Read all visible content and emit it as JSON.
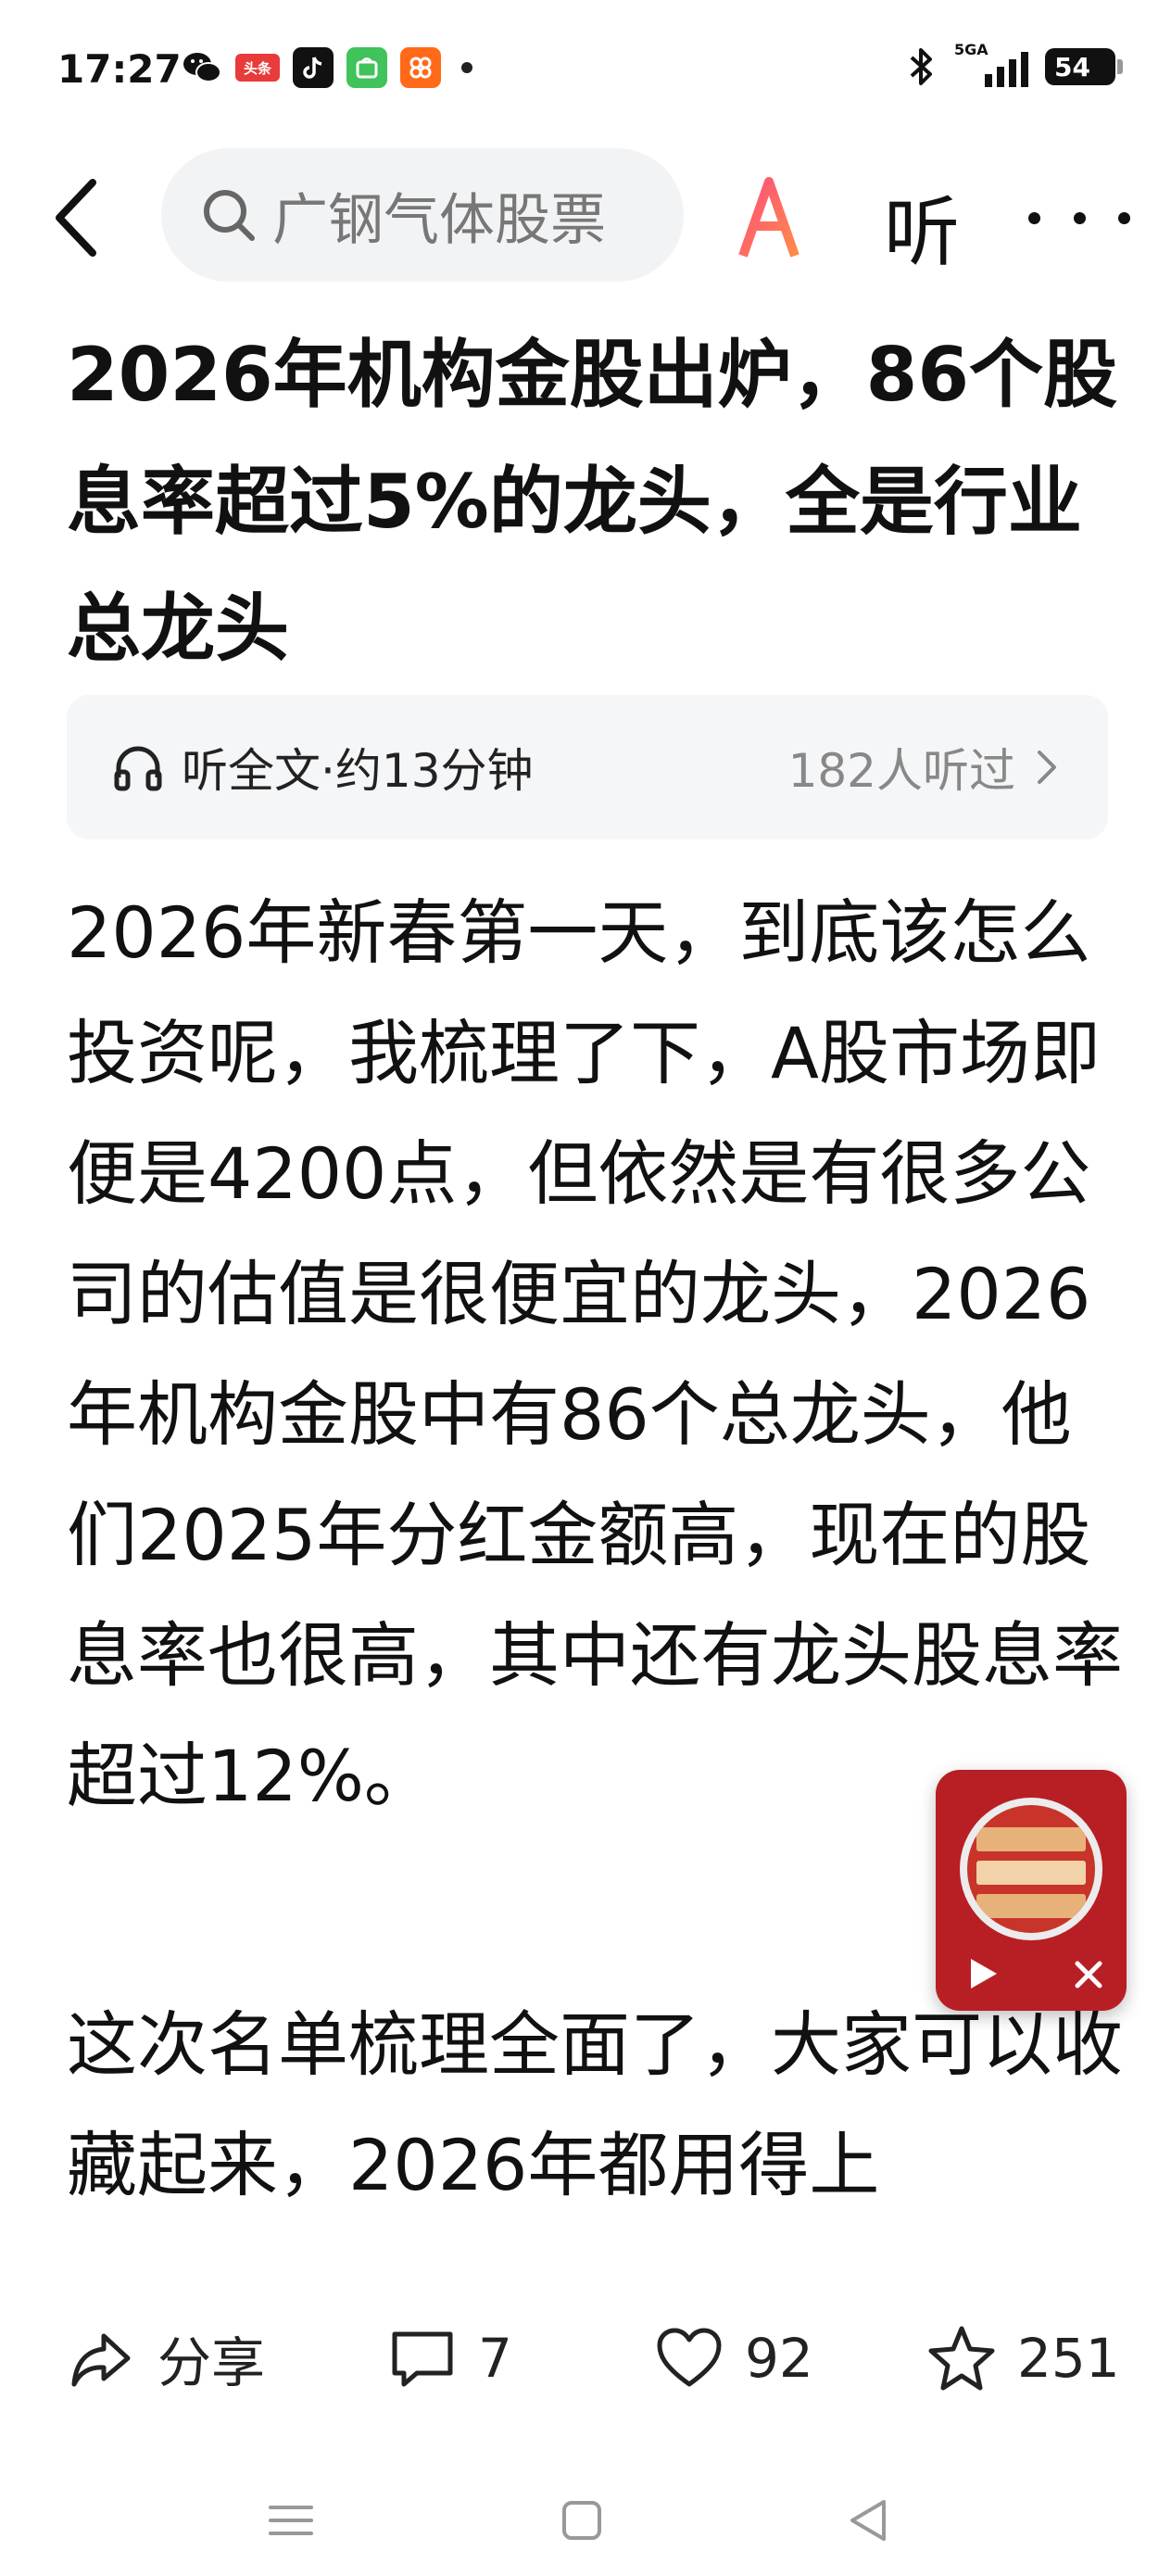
{
  "status_bar": {
    "time": "17:27",
    "apps": [
      "wechat-icon",
      "toutiao-icon",
      "douyin-icon",
      "mini-app-icon",
      "taobao-icon"
    ],
    "toutiao_label": "头条",
    "network": "5GA",
    "battery": "54"
  },
  "nav": {
    "search_placeholder": "广钢气体股票",
    "ai_label": "AI",
    "listen_label": "听"
  },
  "article": {
    "title": "2026年机构金股出炉，86个股息率超过5%的龙头，全是行业总龙头",
    "listen_bar": {
      "label": "听全文·约13分钟",
      "count": "182人听过"
    },
    "paragraphs": [
      "2026年新春第一天，到底该怎么投资呢，我梳理了下，A股市场即便是4200点，但依然是有很多公司的估值是很便宜的龙头，2026年机构金股中有86个总龙头，他们2025年分红金额高，现在的股息率也很高，其中还有龙头股息率超过12%。",
      "这次名单梳理全面了，大家可以收藏起来，2026年都用得上"
    ]
  },
  "actions": {
    "share": "分享",
    "comments": "7",
    "likes": "92",
    "favorites": "251"
  },
  "colors": {
    "accent_red": "#b81f24",
    "ai_gradient_start": "#ff4f7a",
    "ai_gradient_end": "#ff8a4a"
  }
}
